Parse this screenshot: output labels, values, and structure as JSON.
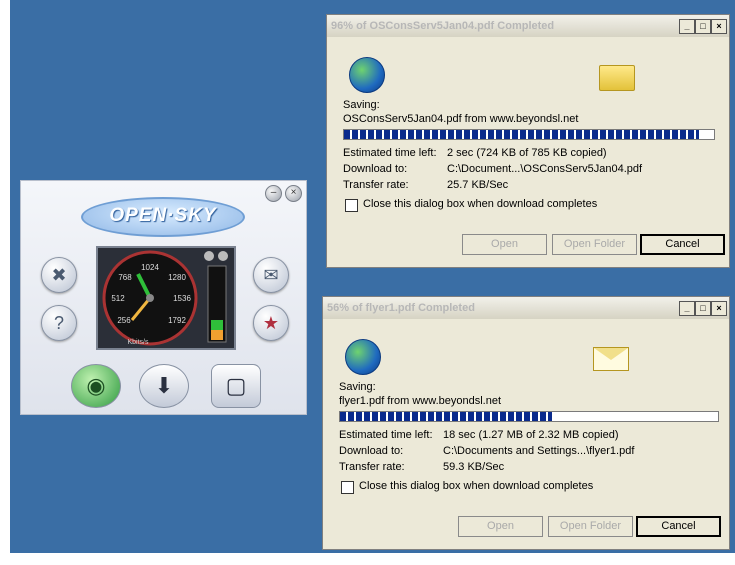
{
  "widget": {
    "logo": "OPEN·SKY",
    "gauge": {
      "ticks": [
        "1024",
        "768",
        "1280",
        "512",
        "1536",
        "256",
        "1792"
      ],
      "unit": "Kbits/s"
    }
  },
  "dialogs": [
    {
      "title": "96% of OSConsServ5Jan04.pdf Completed",
      "saving_label": "Saving:",
      "saving_text": "OSConsServ5Jan04.pdf from www.beyondsl.net",
      "progress": 0.96,
      "est_label": "Estimated time left:",
      "est_value": "2 sec (724 KB of 785 KB copied)",
      "dl_label": "Download to:",
      "dl_value": "C:\\Document...\\OSConsServ5Jan04.pdf",
      "rate_label": "Transfer rate:",
      "rate_value": "25.7 KB/Sec",
      "checkbox_label": "Close this dialog box when download completes",
      "open": "Open",
      "open_folder": "Open Folder",
      "cancel": "Cancel"
    },
    {
      "title": "56% of flyer1.pdf Completed",
      "saving_label": "Saving:",
      "saving_text": "flyer1.pdf from www.beyondsl.net",
      "progress": 0.56,
      "est_label": "Estimated time left:",
      "est_value": "18 sec (1.27 MB of 2.32 MB copied)",
      "dl_label": "Download to:",
      "dl_value": "C:\\Documents and Settings...\\flyer1.pdf",
      "rate_label": "Transfer rate:",
      "rate_value": "59.3 KB/Sec",
      "checkbox_label": "Close this dialog box when download completes",
      "open": "Open",
      "open_folder": "Open Folder",
      "cancel": "Cancel"
    }
  ],
  "colors": {
    "desktop": "#3a6ea5",
    "progress": "#0a2a8c",
    "dialog_bg": "#ece9d8"
  }
}
